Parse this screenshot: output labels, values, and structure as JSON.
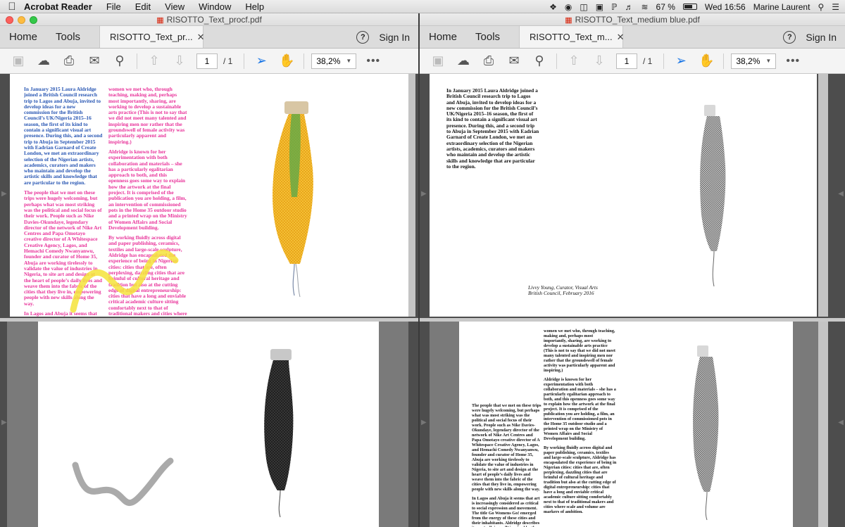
{
  "menubar": {
    "app": "Acrobat Reader",
    "items": [
      "File",
      "Edit",
      "View",
      "Window",
      "Help"
    ],
    "battery": "67 %",
    "clock": "Wed 16:56",
    "user": "Marine Laurent"
  },
  "left_window": {
    "title": "RISOTTO_Text_procf.pdf",
    "tabs": {
      "home": "Home",
      "tools": "Tools",
      "doc": "RISOTTO_Text_pr..."
    },
    "signin": "Sign In",
    "page_number": "1",
    "page_total": "/ 1",
    "zoom": "38,2%"
  },
  "right_window": {
    "title": "RISOTTO_Text_medium blue.pdf",
    "tabs": {
      "home": "Home",
      "tools": "Tools",
      "doc": "RISOTTO_Text_m..."
    },
    "signin": "Sign In",
    "page_number": "1",
    "page_total": "/ 1",
    "zoom": "38,2%"
  },
  "text": {
    "para_intro": "In January 2015 Laura Aldridge joined a British Council research trip to Lagos and Abuja, invited to develop ideas for a new commission for the British Council’s UK/Nigeria 2015–16 season, the first of its kind to contain a significant visual art presence. During this, and a second trip to Abuja in September 2015 with Eadrian Garnard of Create London, we met an extraordinary selection of the Nigerian artists, academics, curators and makers who maintain and develop the artistic skills and knowledge that are particular to the region.",
    "para_people": "The people that we met on these trips were hugely welcoming, but perhaps what was most striking was the political and social focus of their work. People such as Nike Davies-Okundaye, legendary director of the network of Nike Art Centres and Papa Omotayo creative director of A Whitespace Creative Agency, Lagos, and Hemachi Comedy Nwanyanwu, founder and curator of Home 35, Abuja are working tirelessly to validate the value of industries in Nigeria, to site art and design at the heart of people’s daily lives and weave them into the fabric of the cities that they live in, empowering people with new skills along the way.",
    "para_lagos": "In Lagos and Abuja it seems that art is increasingly considered as critical to social expression and movement. The title Go Womens Go! emerged from the energy of these cities and their inhabitants. Aldridge describes it as a ‘rallying call’ inspired by the many",
    "para_women": "women we met who, through teaching, making and, perhaps most importantly, sharing, are working to develop a sustainable arts practice (This is not to say that we did not meet many talented and inspiring men nor rather that the groundswell of female activity was particularly apparent and inspiring.)",
    "para_aldridge": "Aldridge is known for her experimentation with both collaboration and materials – she has a particularly egalitarian approach to both, and this openness goes some way to explain how the artwork at the final project. It is comprised of the publication you are holding, a film, an intervention of commissioned pots in the Home 35 outdoor studio and a printed wrap on the Ministry of Women Affairs and Social Development building.",
    "para_working": "By working fluidly across digital and paper publishing, ceramics, textiles and large-scale sculpture, Aldridge has encapsulated the experience of being in Nigerian cities: cities that are, often perplexing, dazzling cities that are brimful of cultural heritage and tradition but also at the cutting edge of digital entrepreneurship: cities that have a long and enviable critical academic culture sitting comfortably next to that of traditional makers and cities where scale and volume are markers of ambition.",
    "signature_name": "Livvy Young, Curator, Visual Arts",
    "signature_org": "British Council, February 2016"
  }
}
